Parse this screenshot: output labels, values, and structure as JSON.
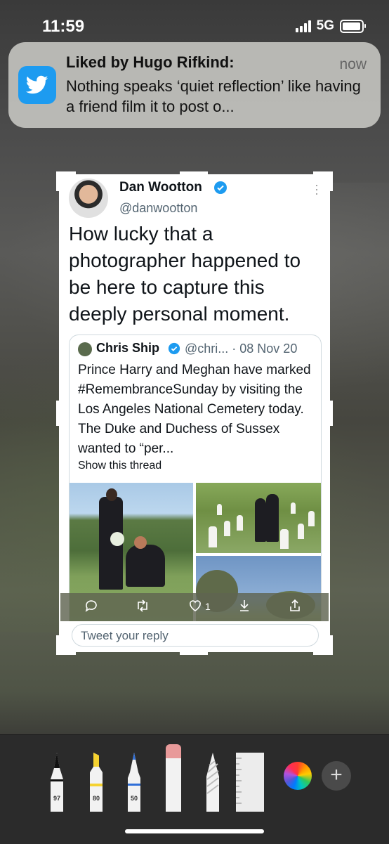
{
  "status_bar": {
    "time": "11:59",
    "network": "5G"
  },
  "notification": {
    "app_icon": "twitter-bird-icon",
    "title": "Liked by Hugo Rifkind:",
    "time": "now",
    "body": "Nothing speaks ‘quiet reflection’ like having a friend film it to post o..."
  },
  "tweet": {
    "author_name": "Dan Wootton",
    "author_handle": "@danwootton",
    "text": "How lucky that a photographer happened to be here to capture this deeply personal moment.",
    "quoted": {
      "author_name": "Chris Ship",
      "meta": "@chri... · 08 Nov 20",
      "text": "Prince Harry and Meghan have marked #RemembranceSunday by visiting the Los Angeles National Cemetery today. The Duke and Duchess of Sussex wanted to “per...",
      "show_thread": "Show this thread"
    },
    "like_count": "1",
    "reply_placeholder": "Tweet your reply"
  },
  "markup_tools": [
    {
      "name": "pen",
      "label": "97"
    },
    {
      "name": "highlighter",
      "label": "80"
    },
    {
      "name": "pencil",
      "label": "50"
    },
    {
      "name": "eraser"
    },
    {
      "name": "lasso"
    },
    {
      "name": "ruler"
    }
  ],
  "colors": {
    "twitter_blue": "#1d9bf0",
    "highlighter_yellow": "#f5d230",
    "pencil_blue": "#2f6fd8",
    "eraser_pink": "#e89a9a"
  }
}
